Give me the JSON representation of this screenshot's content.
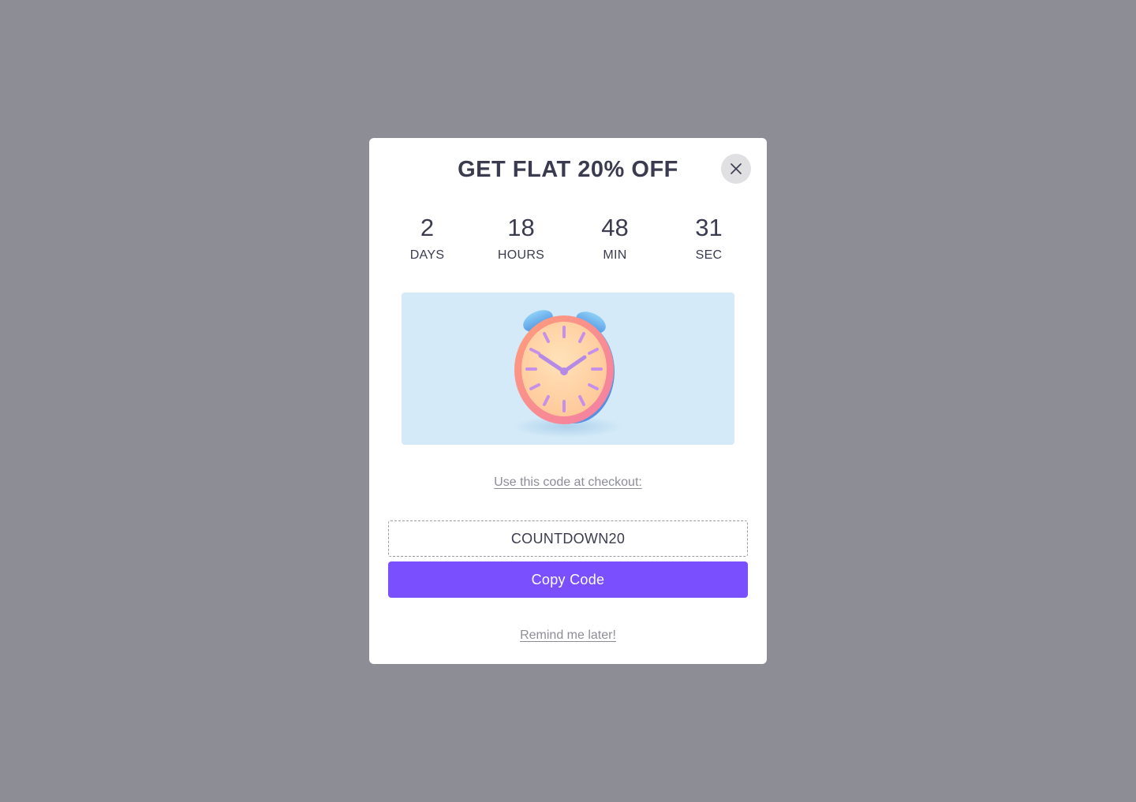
{
  "modal": {
    "title": "GET FLAT 20% OFF",
    "close_icon": "close-icon"
  },
  "countdown": {
    "days": {
      "value": "2",
      "label": "DAYS"
    },
    "hours": {
      "value": "18",
      "label": "HOURS"
    },
    "minutes": {
      "value": "48",
      "label": "MIN"
    },
    "seconds": {
      "value": "31",
      "label": "SEC"
    }
  },
  "hero": {
    "icon": "alarm-clock-icon"
  },
  "checkout": {
    "text": "Use this code at checkout:",
    "code": "COUNTDOWN20",
    "copy_label": "Copy Code"
  },
  "remind": {
    "label": "Remind me later!"
  },
  "colors": {
    "overlay": "#8d8d96",
    "accent": "#7a4ffe",
    "hero_bg": "#d4eaf8",
    "text_primary": "#3b3b4f",
    "text_muted": "#8d8d96"
  }
}
